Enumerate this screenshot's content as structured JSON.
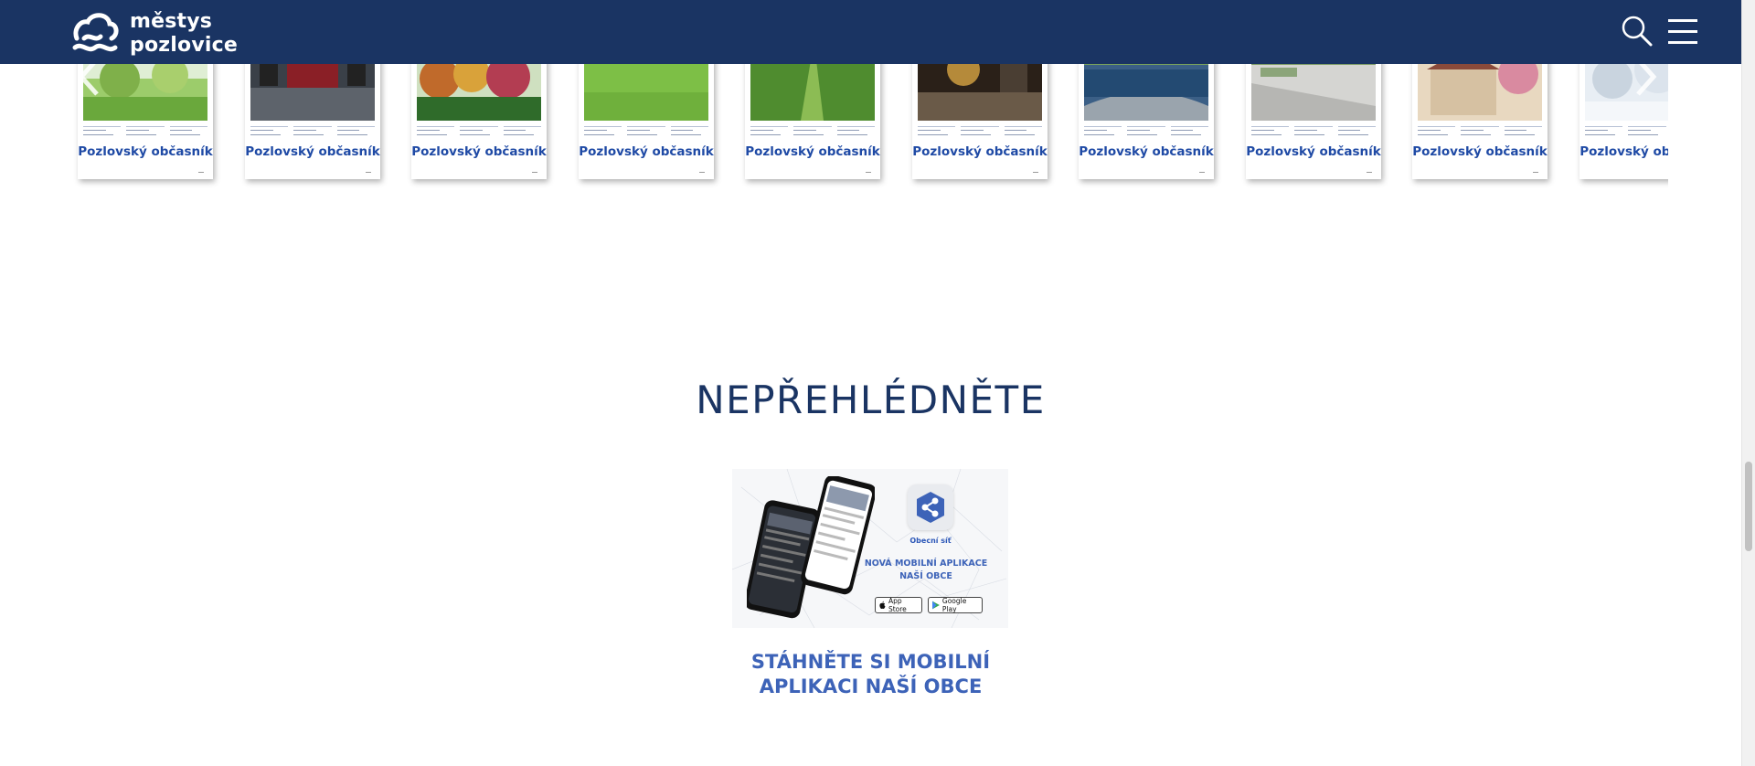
{
  "header": {
    "logo_line1": "městys",
    "logo_line2": "pozlovice",
    "icons": [
      "logo-icon",
      "search-icon",
      "menu-icon"
    ]
  },
  "carousel": {
    "items": [
      {
        "title": "Pozlovský občasník",
        "theme": "orchard"
      },
      {
        "title": "Pozlovský občasník",
        "theme": "stage"
      },
      {
        "title": "Pozlovský občasník",
        "theme": "autumn"
      },
      {
        "title": "Pozlovský občasník",
        "theme": "meadow"
      },
      {
        "title": "Pozlovský občasník",
        "theme": "path"
      },
      {
        "title": "Pozlovský občasník",
        "theme": "night"
      },
      {
        "title": "Pozlovský občasník",
        "theme": "reservoir"
      },
      {
        "title": "Pozlovský občasník",
        "theme": "pavement"
      },
      {
        "title": "Pozlovský občasník",
        "theme": "house"
      },
      {
        "title": "Pozlovský občasník",
        "theme": "snow"
      }
    ],
    "prev_icon": "chevron-left-icon",
    "next_icon": "chevron-right-icon"
  },
  "section": {
    "title": "NEPŘEHLÉDNĚTE"
  },
  "promo": {
    "share_caption": "Obecní síť",
    "banner_line1": "NOVÁ MOBILNÍ APLIKACE",
    "banner_line2": "NAŠÍ OBCE",
    "app_store": "App Store",
    "google_play": "Google Play",
    "caption_line1": "STÁHNĚTE SI MOBILNÍ",
    "caption_line2": "APLIKACI NAŠÍ OBCE"
  },
  "colors": {
    "header_bg": "#1a3463",
    "accent_blue": "#3d63b8",
    "title_blue": "#1a3463"
  }
}
